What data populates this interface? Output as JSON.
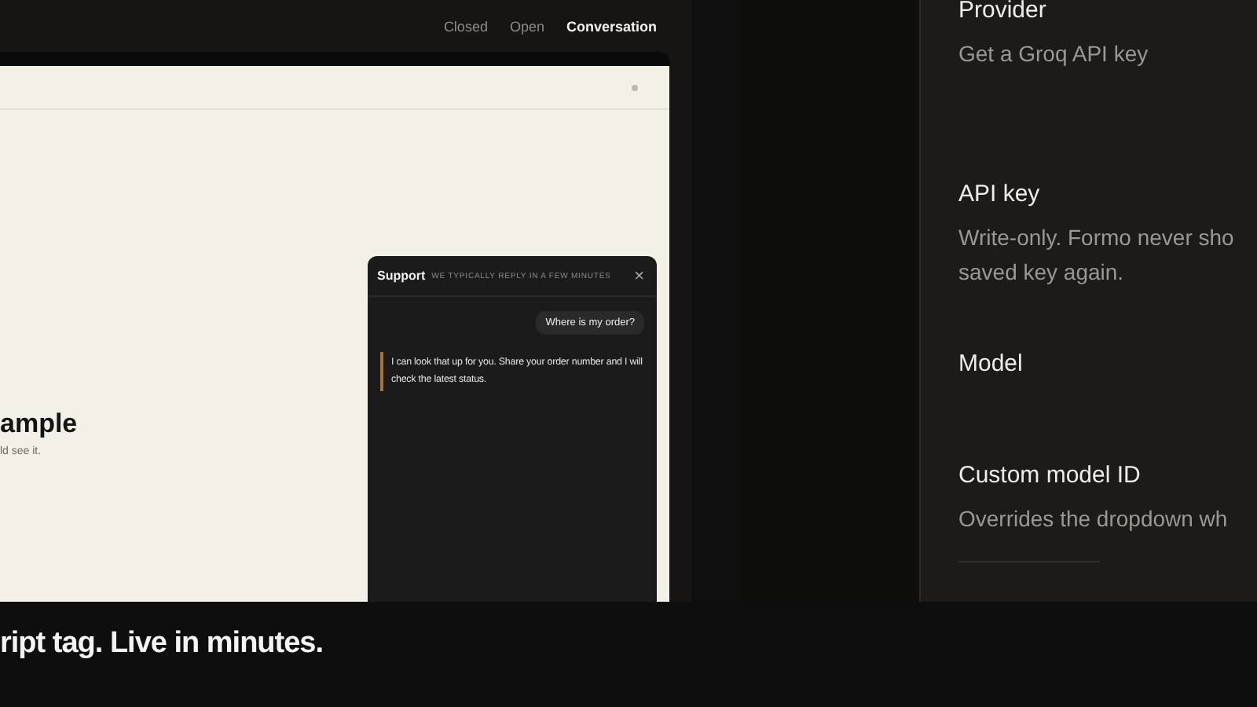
{
  "demo": {
    "tabs": [
      {
        "label": "Closed",
        "selected": false
      },
      {
        "label": "Open",
        "selected": false
      },
      {
        "label": "Conversation",
        "selected": true
      }
    ],
    "heading": "ample",
    "subtext": "ld see it.",
    "chat": {
      "title": "Support",
      "subtitle": "WE TYPICALLY REPLY IN A FEW MINUTES",
      "close": "×",
      "messages": [
        {
          "kind": "user",
          "text": "Where is my order?"
        },
        {
          "kind": "bot",
          "text": "I can look that up for you. Share your order number and I will check the latest status."
        }
      ]
    }
  },
  "settings": [
    {
      "label": "Provider",
      "hint": "Get a Groq API key"
    },
    {
      "label": "API key",
      "hint": "Write-only. Formo never sho\nsaved key again."
    },
    {
      "label": "Model"
    },
    {
      "label": "Custom model ID",
      "hint": "Overrides the dropdown wh"
    }
  ],
  "caption": "ript tag. Live in minutes."
}
